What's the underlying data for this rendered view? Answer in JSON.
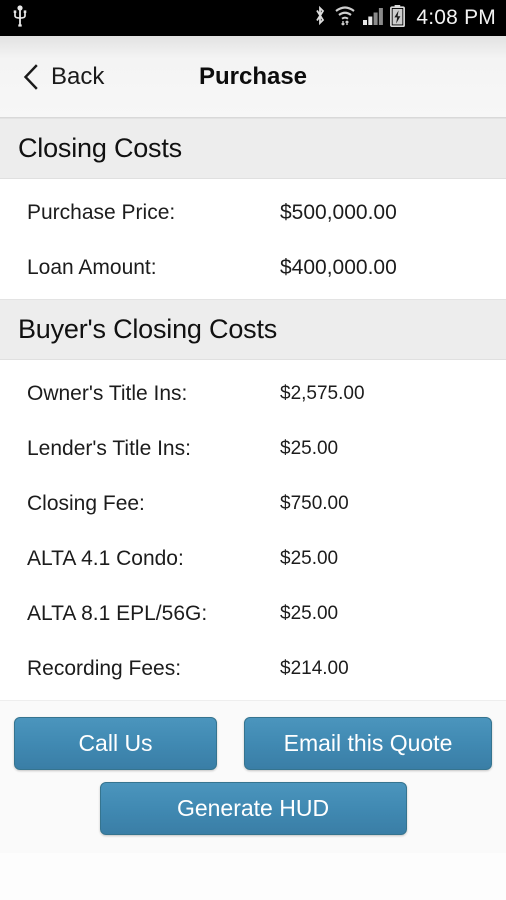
{
  "status_bar": {
    "usb_icon": "usb-icon",
    "bluetooth_icon": "bluetooth-icon",
    "wifi_icon": "wifi-icon",
    "signal_icon": "cellular-signal-icon",
    "battery_icon": "battery-charging-icon",
    "time": "4:08 PM"
  },
  "nav": {
    "back_label": "Back",
    "back_icon": "chevron-left-icon",
    "title": "Purchase"
  },
  "sections": [
    {
      "title": "Closing Costs",
      "rows": [
        {
          "label": "Purchase Price:",
          "value": "$500,000.00"
        },
        {
          "label": "Loan Amount:",
          "value": "$400,000.00"
        }
      ]
    },
    {
      "title": "Buyer's Closing Costs",
      "rows": [
        {
          "label": "Owner's Title Ins:",
          "value": "$2,575.00"
        },
        {
          "label": "Lender's Title Ins:",
          "value": "$25.00"
        },
        {
          "label": "Closing Fee:",
          "value": "$750.00"
        },
        {
          "label": "ALTA 4.1 Condo:",
          "value": "$25.00"
        },
        {
          "label": "ALTA 8.1 EPL/56G:",
          "value": "$25.00"
        },
        {
          "label": "Recording Fees:",
          "value": "$214.00"
        }
      ]
    }
  ],
  "actions": {
    "call": "Call Us",
    "email": "Email this Quote",
    "hud": "Generate HUD"
  },
  "colors": {
    "button_blue": "#4089b2",
    "section_header_bg": "#ededed",
    "status_bar_bg": "#000000",
    "nav_bg": "#f4f4f4"
  }
}
